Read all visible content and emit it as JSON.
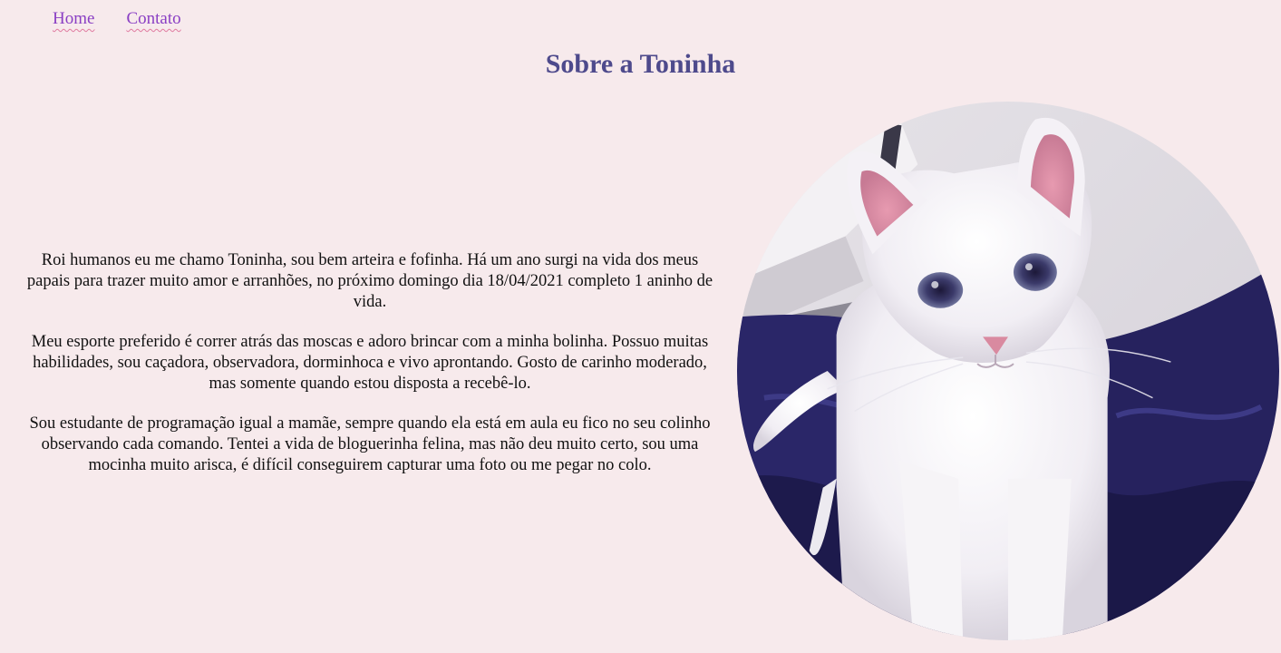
{
  "nav": {
    "links": [
      {
        "label": "Home"
      },
      {
        "label": "Contato"
      }
    ]
  },
  "page": {
    "title": "Sobre a Toninha"
  },
  "bio": {
    "paragraphs": [
      "Roi humanos eu me chamo Toninha, sou bem arteira e fofinha. Há um ano surgi na vida dos meus papais para trazer muito amor e arranhões, no próximo domingo dia 18/04/2021 completo 1 aninho de vida.",
      "Meu esporte preferido é correr atrás das moscas e adoro brincar com a minha bolinha. Possuo muitas habilidades, sou caçadora, observadora, dorminhoca e vivo aprontando. Gosto de carinho moderado, mas somente quando estou disposta a recebê-lo.",
      "Sou estudante de programação igual a mamãe, sempre quando ela está em aula eu fico no seu colinho observando cada comando. Tentei a vida de bloguerinha felina, mas não deu muito certo, sou uma mocinha muito arisca, é difícil conseguirem capturar uma foto ou me pegar no colo."
    ]
  },
  "photo": {
    "subject": "white-kitten-on-navy-blanket"
  },
  "colors": {
    "background": "#f7eaec",
    "link": "#8a3fc4",
    "title": "#4e4a8c",
    "text": "#111111"
  }
}
